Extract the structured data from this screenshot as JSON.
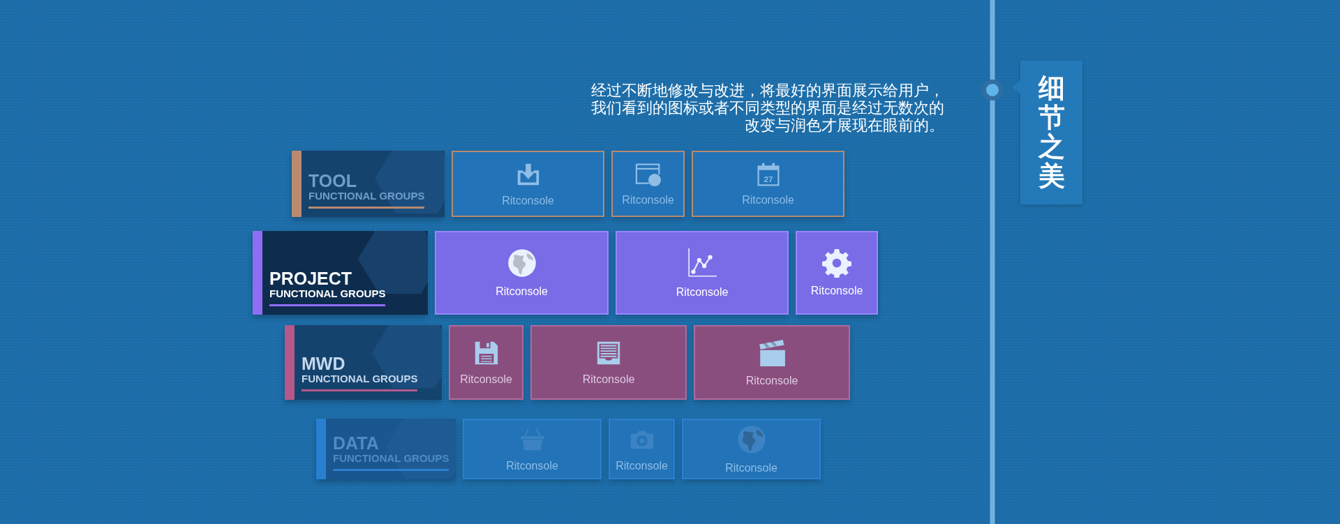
{
  "intro": {
    "lines": [
      "经过不断地修改与改进，将最好的界面展示给用户，",
      "我们看到的图标或者不同类型的界面是经过无数次的",
      "改变与润色才展现在眼前的。"
    ]
  },
  "side_label": {
    "text": "细节之美"
  },
  "groups": [
    {
      "title": "TOOL",
      "subtitle": "FUNCTIONAL GROUPS",
      "color": "#b98a70",
      "dimmed": true,
      "tiles": [
        {
          "kind": "download",
          "label": "Ritconsole"
        },
        {
          "kind": "browser-globe",
          "label": "Ritconsole"
        },
        {
          "kind": "calendar",
          "icon_text": "27",
          "label": "Ritconsole"
        }
      ]
    },
    {
      "title": "PROJECT",
      "subtitle": "FUNCTIONAL GROUPS",
      "color": "#8f6df5",
      "dimmed": false,
      "tiles": [
        {
          "kind": "globe",
          "label": "Ritconsole"
        },
        {
          "kind": "chart",
          "label": "Ritconsole"
        },
        {
          "kind": "gear",
          "label": "Ritconsole"
        }
      ]
    },
    {
      "title": "MWD",
      "subtitle": "FUNCTIONAL GROUPS",
      "color": "#b5588a",
      "dimmed": false,
      "tiles": [
        {
          "kind": "floppy",
          "label": "Ritconsole"
        },
        {
          "kind": "tray",
          "label": "Ritconsole"
        },
        {
          "kind": "clapper",
          "label": "Ritconsole"
        }
      ]
    },
    {
      "title": "DATA",
      "subtitle": "FUNCTIONAL GROUPS",
      "color": "#2a80d0",
      "dimmed": true,
      "tiles": [
        {
          "kind": "basket",
          "label": "Ritconsole"
        },
        {
          "kind": "camera",
          "label": "Ritconsole"
        },
        {
          "kind": "globe",
          "label": "Ritconsole"
        }
      ]
    }
  ]
}
